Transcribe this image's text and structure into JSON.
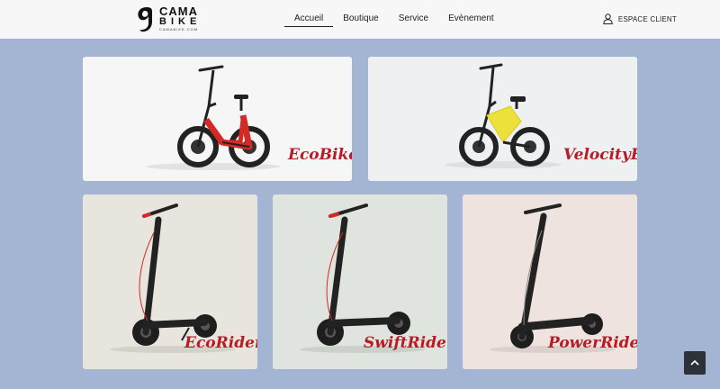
{
  "header": {
    "logo": {
      "line1": "CAMA",
      "line2": "BIKE",
      "line3": "CAMABIKE.COM"
    },
    "nav": [
      {
        "label": "Accueil",
        "active": true
      },
      {
        "label": "Boutique",
        "active": false
      },
      {
        "label": "Service",
        "active": false
      },
      {
        "label": "Evènement",
        "active": false
      }
    ],
    "client_label": "ESPACE CLIENT",
    "client_icon": "user-icon"
  },
  "products": [
    {
      "label": "EcoBike",
      "kind": "e-bike",
      "color": "#d42a25"
    },
    {
      "label": "VelocityE",
      "kind": "e-bike",
      "color": "#ece03a"
    },
    {
      "label": "EcoRider",
      "kind": "scooter",
      "accent": "#d42a25"
    },
    {
      "label": "SwiftRider",
      "kind": "scooter",
      "accent": "#d42a25"
    },
    {
      "label": "PowerRider",
      "kind": "scooter",
      "accent": "#888888"
    }
  ],
  "theme": {
    "background": "#a3b5d2",
    "header": "#f7f7f7",
    "label_color": "#b71c24"
  },
  "scroll_top_icon": "chevron-up-icon"
}
